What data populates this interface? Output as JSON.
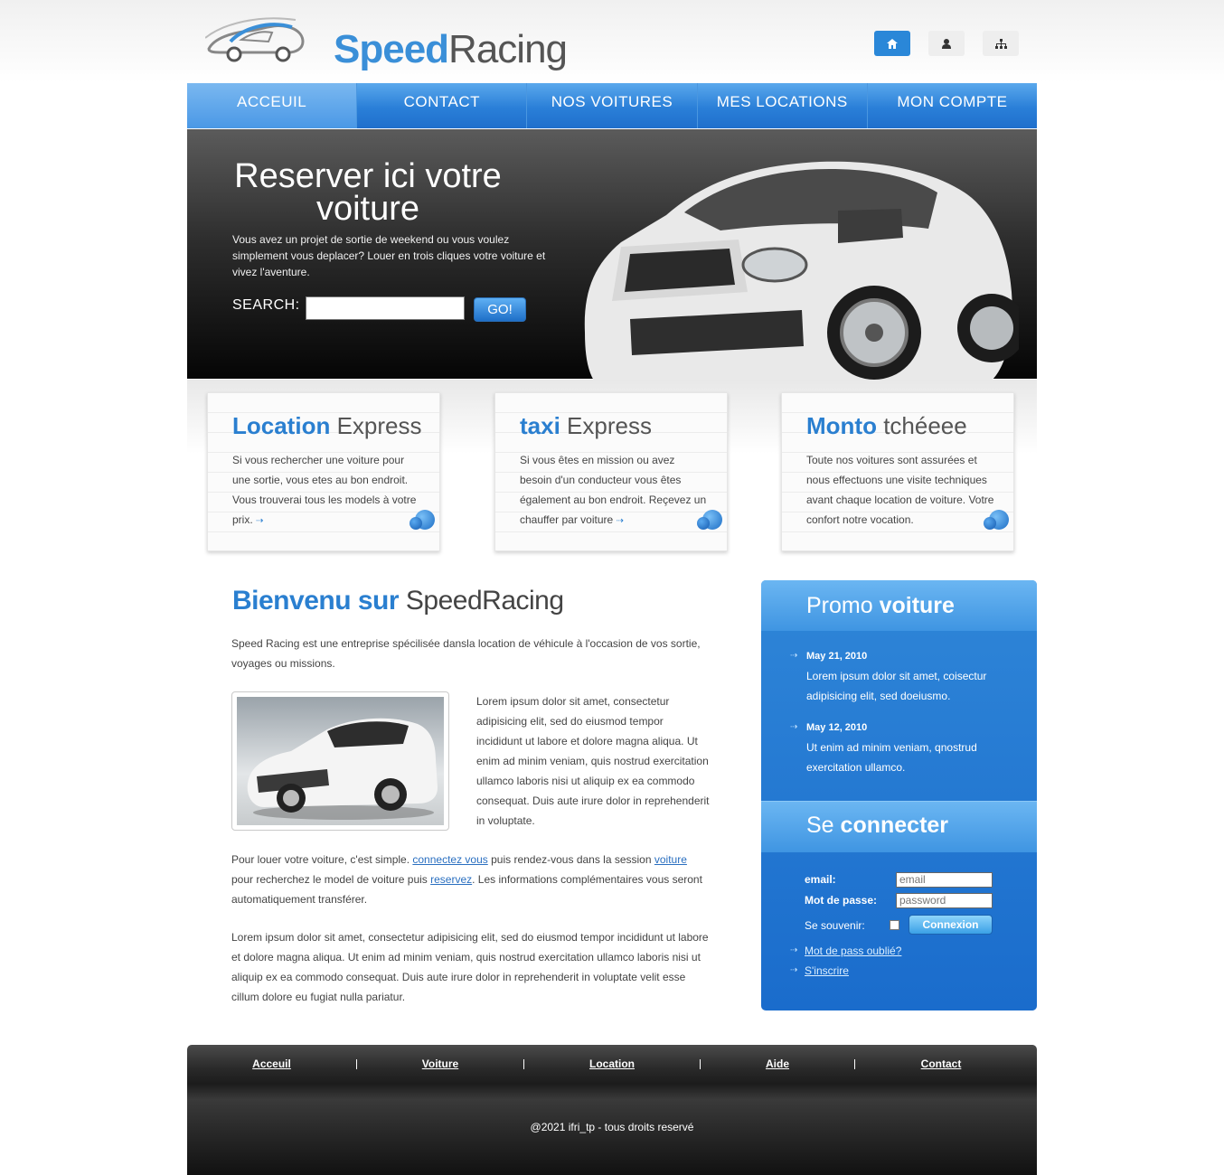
{
  "header": {
    "logo_speed": "Speed",
    "logo_racing": "Racing",
    "icons": [
      "home-icon",
      "user-icon",
      "sitemap-icon"
    ]
  },
  "nav": {
    "items": [
      "ACCEUIL",
      "CONTACT",
      "NOS VOITURES",
      "MES LOCATIONS",
      "MON COMPTE"
    ],
    "active": "ACCEUIL"
  },
  "hero": {
    "title_line1": "Reserver ici votre",
    "title_line2": "voiture",
    "text": "Vous avez un projet de sortie de weekend ou vous voulez simplement vous deplacer? Louer en trois cliques votre voiture et vivez l'aventure.",
    "search_label": "SEARCH:",
    "search_value": "",
    "go_label": "GO!"
  },
  "boxes": [
    {
      "title_bold": "Location",
      "title_rest": "Express",
      "text": "Si vous rechercher une voiture pour une sortie, vous etes au bon endroit. Vous trouverai tous les models à votre prix."
    },
    {
      "title_bold": "taxi",
      "title_rest": "Express",
      "text": "Si vous êtes en mission ou avez besoin d'un conducteur vous êtes également au bon endroit. Reçevez un chauffer par voiture"
    },
    {
      "title_bold": "Monto",
      "title_rest": "tchéeee",
      "text": "Toute nos voitures sont assurées et nous effectuons une visite techniques avant chaque location de voiture. Votre confort notre vocation."
    }
  ],
  "welcome": {
    "title_bold": "Bienvenu sur",
    "title_rest": "SpeedRacing",
    "intro": "Speed Racing est une entreprise spécilisée dansla location de véhicule à l'occasion de vos sortie, voyages ou missions.",
    "column_text": "Lorem ipsum dolor sit amet, consectetur adipisicing elit, sed do eiusmod tempor incididunt ut labore et dolore magna aliqua. Ut enim ad minim veniam, quis nostrud exercitation ullamco laboris nisi ut aliquip ex ea commodo consequat. Duis aute irure dolor in reprehenderit in voluptate.",
    "p2_a": "Pour louer votre voiture, c'est simple. ",
    "p2_link1": "connectez vous",
    "p2_b": " puis rendez-vous dans la session ",
    "p2_link2": "voiture",
    "p2_c": " pour recherchez le model de voiture puis ",
    "p2_link3": "reservez",
    "p2_d": ". Les informations complémentaires vous seront automatiquement transférer.",
    "p3": "Lorem ipsum dolor sit amet, consectetur adipisicing elit, sed do eiusmod tempor incididunt ut labore et dolore magna aliqua. Ut enim ad minim veniam, quis nostrud exercitation ullamco laboris nisi ut aliquip ex ea commodo consequat. Duis aute irure dolor in reprehenderit in voluptate velit esse cillum dolore eu fugiat nulla pariatur."
  },
  "promo": {
    "title_a": "Promo",
    "title_b": "voiture",
    "items": [
      {
        "date": "May 21, 2010",
        "text": "Lorem ipsum dolor sit amet, coisectur adipisicing elit, sed doeiusmo."
      },
      {
        "date": "May 12, 2010",
        "text": "Ut enim ad minim veniam, qnostrud exercitation ullamco."
      }
    ]
  },
  "login": {
    "title_a": "Se",
    "title_b": "connecter",
    "email_label": "email:",
    "email_placeholder": "email",
    "password_label": "Mot de passe:",
    "password_placeholder": "password",
    "remember_label": "Se souvenir:",
    "button_label": "Connexion",
    "forgot_link": "Mot de pass oublié?",
    "register_link": "S'inscrire"
  },
  "footer": {
    "links": [
      "Acceuil",
      "Voiture",
      "Location",
      "Aide",
      "Contact"
    ],
    "copyright": "@2021 ifri_tp - tous droits reservé"
  },
  "colors": {
    "accent": "#2a7fd0",
    "nav": "#2a7fd8",
    "sidebar": "#1a6ccc",
    "hero_dark": "#050505"
  }
}
